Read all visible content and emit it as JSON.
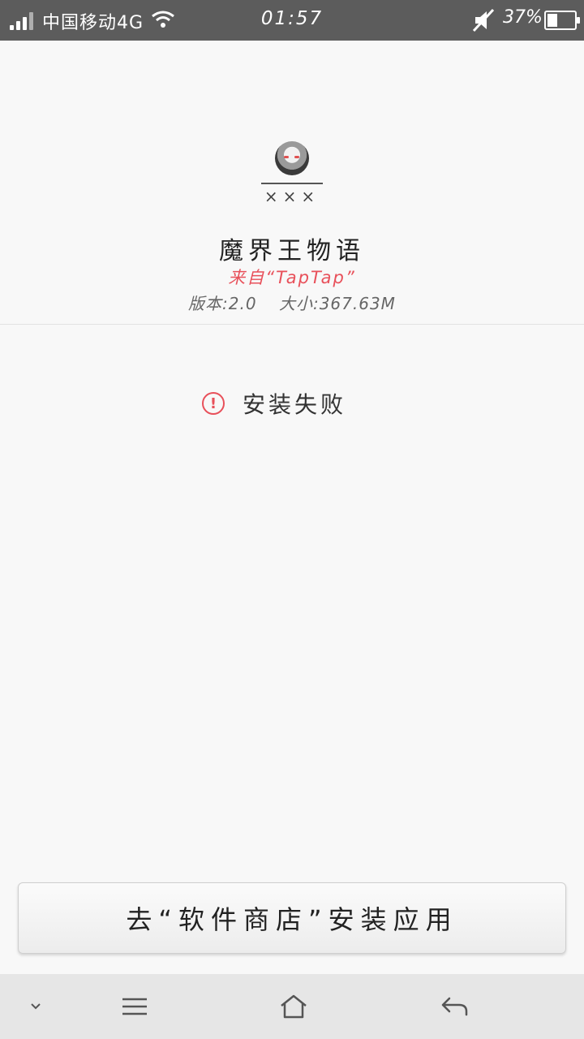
{
  "status_bar": {
    "carrier": "中国移动4G",
    "time": "01:57",
    "battery_percent": "37%",
    "battery_level": 0.37,
    "icons": [
      "signal-icon",
      "wifi-icon",
      "mute-icon",
      "battery-icon"
    ]
  },
  "app": {
    "avatar_caption": "×××",
    "name": "魔界王物语",
    "source": "来自“TapTap”",
    "version": "版本:2.0",
    "size": "大小:367.63M"
  },
  "result": {
    "icon": "exclamation-circle-icon",
    "message": "安装失败",
    "accent_color": "#e8505a"
  },
  "actions": {
    "store_button_label": "去“软件商店”安装应用"
  },
  "nav_bar": {
    "icons": [
      "chevron-down-icon",
      "menu-icon",
      "home-icon",
      "back-icon"
    ]
  }
}
